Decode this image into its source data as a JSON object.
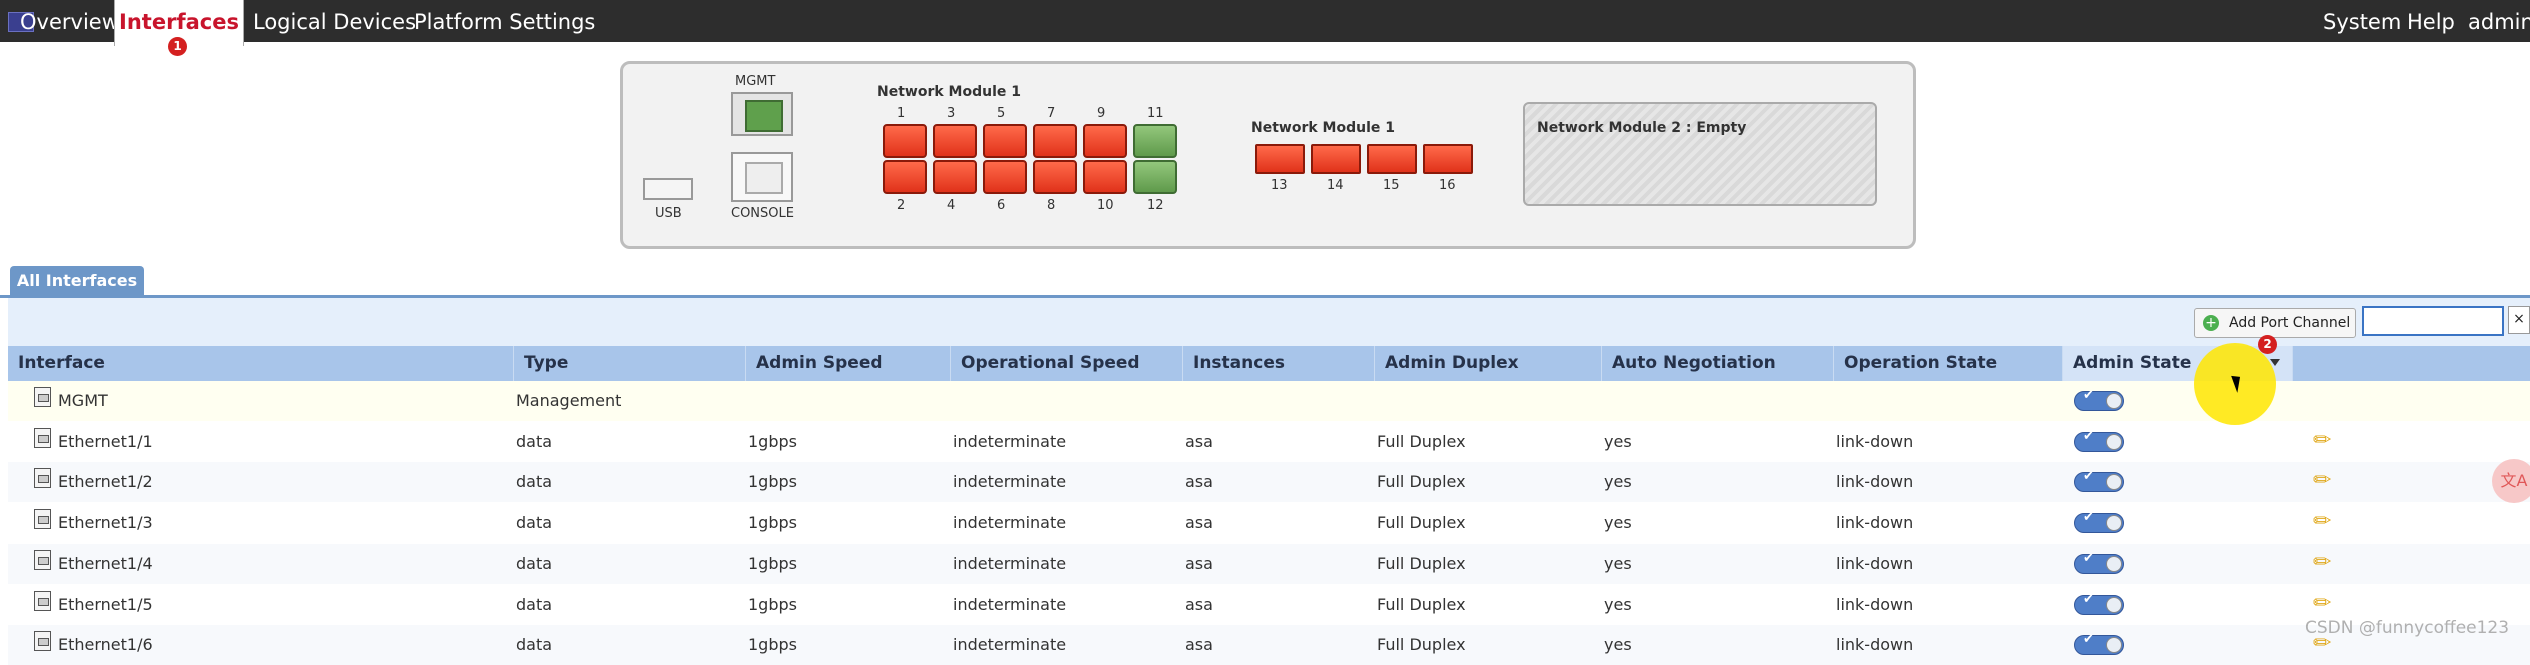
{
  "nav": {
    "overview": "Overview",
    "interfaces": "Interfaces",
    "interfaces_badge": "1",
    "logical_devices": "Logical Devices",
    "platform_settings": "Platform Settings",
    "system": "System",
    "help": "Help",
    "admin": "admin"
  },
  "chassis": {
    "mgmt_label": "MGMT",
    "console_label": "CONSOLE",
    "usb_label": "USB",
    "network_module_1_label": "Network Module 1",
    "network_module_1b_label": "Network Module 1",
    "network_module_2_label": "Network Module 2 : Empty",
    "top_port_numbers": [
      "1",
      "3",
      "5",
      "7",
      "9",
      "11"
    ],
    "bottom_port_numbers": [
      "2",
      "4",
      "6",
      "8",
      "10",
      "12"
    ],
    "sfp_port_numbers": [
      "13",
      "14",
      "15",
      "16"
    ],
    "up_ports": [
      "11",
      "12"
    ],
    "colors": {
      "port_down": "#e0321a",
      "port_up": "#5f9a4b"
    }
  },
  "tabs": {
    "all_interfaces": "All Interfaces"
  },
  "toolbar": {
    "add_port_channel": "Add Port Channel",
    "search_value": "",
    "clear": "×"
  },
  "table": {
    "sort_badge": "2",
    "columns": [
      "Interface",
      "Type",
      "Admin Speed",
      "Operational Speed",
      "Instances",
      "Admin Duplex",
      "Auto Negotiation",
      "Operation State",
      "Admin State"
    ],
    "rows": [
      {
        "interface": "MGMT",
        "type": "Management",
        "admin_speed": "",
        "operational_speed": "",
        "instances": "",
        "admin_duplex": "",
        "auto_negotiation": "",
        "operation_state": "",
        "admin_state": "enabled"
      },
      {
        "interface": "Ethernet1/1",
        "type": "data",
        "admin_speed": "1gbps",
        "operational_speed": "indeterminate",
        "instances": "asa",
        "admin_duplex": "Full Duplex",
        "auto_negotiation": "yes",
        "operation_state": "link-down",
        "admin_state": "enabled"
      },
      {
        "interface": "Ethernet1/2",
        "type": "data",
        "admin_speed": "1gbps",
        "operational_speed": "indeterminate",
        "instances": "asa",
        "admin_duplex": "Full Duplex",
        "auto_negotiation": "yes",
        "operation_state": "link-down",
        "admin_state": "enabled"
      },
      {
        "interface": "Ethernet1/3",
        "type": "data",
        "admin_speed": "1gbps",
        "operational_speed": "indeterminate",
        "instances": "asa",
        "admin_duplex": "Full Duplex",
        "auto_negotiation": "yes",
        "operation_state": "link-down",
        "admin_state": "enabled"
      },
      {
        "interface": "Ethernet1/4",
        "type": "data",
        "admin_speed": "1gbps",
        "operational_speed": "indeterminate",
        "instances": "asa",
        "admin_duplex": "Full Duplex",
        "auto_negotiation": "yes",
        "operation_state": "link-down",
        "admin_state": "enabled"
      },
      {
        "interface": "Ethernet1/5",
        "type": "data",
        "admin_speed": "1gbps",
        "operational_speed": "indeterminate",
        "instances": "asa",
        "admin_duplex": "Full Duplex",
        "auto_negotiation": "yes",
        "operation_state": "link-down",
        "admin_state": "enabled"
      },
      {
        "interface": "Ethernet1/6",
        "type": "data",
        "admin_speed": "1gbps",
        "operational_speed": "indeterminate",
        "instances": "asa",
        "admin_duplex": "Full Duplex",
        "auto_negotiation": "yes",
        "operation_state": "link-down",
        "admin_state": "enabled"
      }
    ]
  },
  "watermark": "CSDN @funnycoffee123",
  "icons": [
    "logo-icon",
    "mgmt-port-icon",
    "console-port-icon",
    "usb-port-icon",
    "add-icon",
    "clear-icon",
    "sort-arrow-icon",
    "interface-icon",
    "toggle-icon",
    "edit-icon",
    "cursor-icon"
  ]
}
